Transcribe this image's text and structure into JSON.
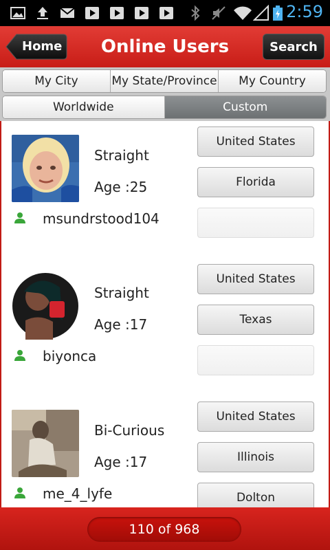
{
  "status_bar": {
    "time": "2:59",
    "icons": [
      "picture-icon",
      "upload-icon",
      "gmail-icon",
      "play-icon",
      "play-icon",
      "play-icon",
      "play-icon",
      "bluetooth-icon",
      "mute-icon",
      "wifi-icon",
      "signal-icon",
      "battery-icon"
    ]
  },
  "header": {
    "home_label": "Home",
    "title": "Online Users",
    "search_label": "Search"
  },
  "tabs": {
    "row1": [
      "My City",
      "My State/Province",
      "My Country"
    ],
    "row2": [
      "Worldwide",
      "Custom"
    ],
    "active": "Custom"
  },
  "users": [
    {
      "orientation": "Straight",
      "age": "Age :25",
      "username": "msundrstood104",
      "country": "United States",
      "state": "Florida",
      "city": ""
    },
    {
      "orientation": "Straight",
      "age": "Age :17",
      "username": "biyonca",
      "country": "United States",
      "state": "Texas",
      "city": ""
    },
    {
      "orientation": "Bi-Curious",
      "age": "Age :17",
      "username": "me_4_lyfe",
      "country": "United States",
      "state": "Illinois",
      "city": "Dolton"
    }
  ],
  "footer": {
    "pager": "110 of 968"
  },
  "colors": {
    "header_red": "#d42a23",
    "user_icon_green": "#3aa63a",
    "time_blue": "#4fb4f2"
  }
}
